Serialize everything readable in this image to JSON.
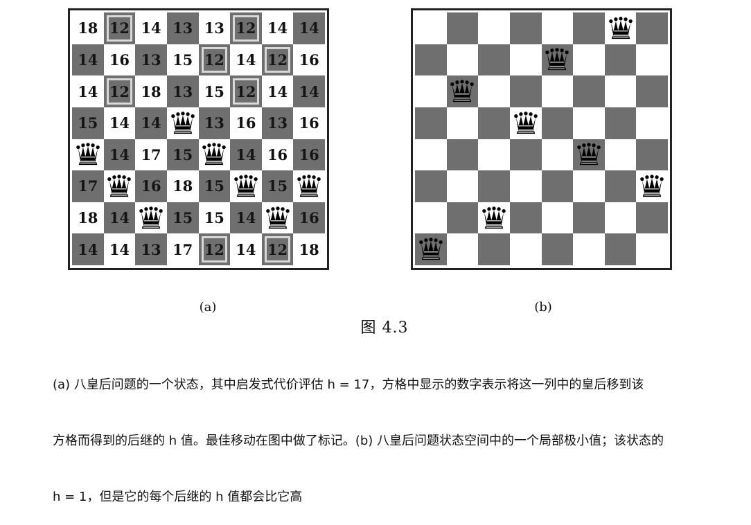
{
  "figure": {
    "title": "图  4.3",
    "subcaption_a": "(a)",
    "subcaption_b": "(b)",
    "caption_lines": [
      "(a) 八皇后问题的一个状态，其中启发式代价评估 h = 17，方格中显示的数字表示将这一列中的皇后移到该",
      "方格而得到的后继的 h 值。最佳移动在图中做了标记。(b) 八皇后问题状态空间中的一个局部极小值；该状态的",
      "h = 1，但是它的每个后继的 h 值都会比它高"
    ]
  },
  "board_a": {
    "rows": [
      [
        "18",
        "12",
        "14",
        "13",
        "13",
        "12",
        "14",
        "14"
      ],
      [
        "14",
        "16",
        "13",
        "15",
        "12",
        "14",
        "12",
        "16"
      ],
      [
        "14",
        "12",
        "18",
        "13",
        "15",
        "12",
        "14",
        "14"
      ],
      [
        "15",
        "14",
        "14",
        "Q",
        "13",
        "16",
        "13",
        "16"
      ],
      [
        "Q",
        "14",
        "17",
        "15",
        "Q",
        "14",
        "16",
        "16"
      ],
      [
        "17",
        "Q",
        "16",
        "18",
        "15",
        "Q",
        "15",
        "Q"
      ],
      [
        "18",
        "14",
        "Q",
        "15",
        "15",
        "14",
        "Q",
        "16"
      ],
      [
        "14",
        "14",
        "13",
        "17",
        "12",
        "14",
        "12",
        "18"
      ]
    ],
    "marked": [
      [
        0,
        1
      ],
      [
        0,
        5
      ],
      [
        1,
        4
      ],
      [
        1,
        6
      ],
      [
        2,
        1
      ],
      [
        2,
        5
      ],
      [
        7,
        4
      ],
      [
        7,
        6
      ]
    ]
  },
  "board_b": {
    "queens": [
      [
        0,
        6
      ],
      [
        1,
        4
      ],
      [
        2,
        1
      ],
      [
        3,
        3
      ],
      [
        4,
        5
      ],
      [
        5,
        7
      ],
      [
        6,
        2
      ],
      [
        7,
        0
      ]
    ]
  },
  "icons": {
    "queen": "queen-icon"
  }
}
